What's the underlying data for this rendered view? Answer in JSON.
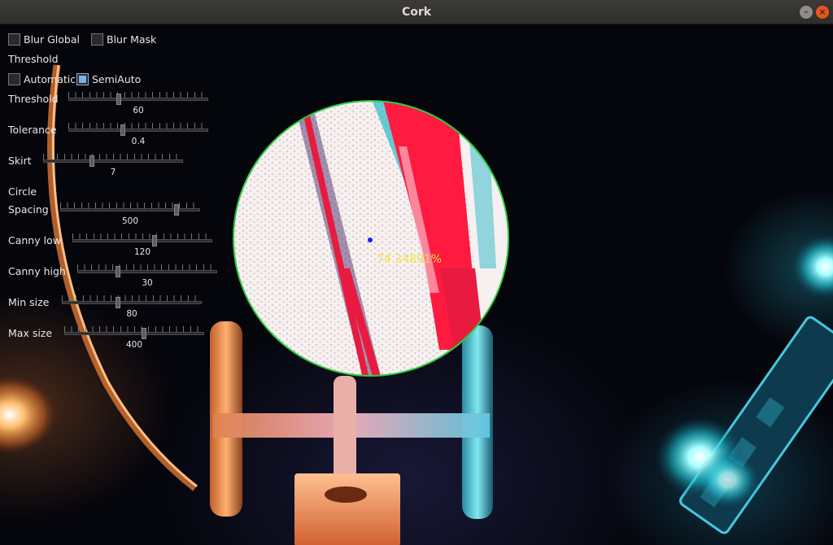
{
  "window": {
    "title": "Cork",
    "minimize_glyph": "–",
    "close_glyph": "×"
  },
  "controls": {
    "blur_global": {
      "label": "Blur Global",
      "checked": false
    },
    "blur_mask": {
      "label": "Blur Mask",
      "checked": false
    },
    "threshold_heading": "Threshold",
    "automatic": {
      "label": "Automatic",
      "checked": false
    },
    "semiauto": {
      "label": "SemiAuto",
      "checked": true
    },
    "threshold": {
      "label": "Threshold",
      "value": "60",
      "fraction": 0.36
    },
    "tolerance": {
      "label": "Tolerance",
      "value": "0.4",
      "fraction": 0.39
    },
    "skirt": {
      "label": "Skirt",
      "value": "7",
      "fraction": 0.35
    },
    "circle_heading": "Circle",
    "spacing": {
      "label": "Spacing",
      "value": "500",
      "fraction": 0.83
    },
    "canny_low": {
      "label": "Canny low",
      "value": "120",
      "fraction": 0.59
    },
    "canny_high": {
      "label": "Canny high",
      "value": "30",
      "fraction": 0.29
    },
    "min_size": {
      "label": "Min size",
      "value": "80",
      "fraction": 0.4
    },
    "max_size": {
      "label": "Max size",
      "value": "400",
      "fraction": 0.57
    }
  },
  "detection": {
    "readout": "74.34891%",
    "circle_color": "#2ecc40",
    "readout_color": "#f0e24a",
    "center_marker_color": "#1020ff",
    "defect_color": "#ff1a40"
  },
  "icons": {
    "minimize": "minimize-icon",
    "close": "close-icon"
  }
}
